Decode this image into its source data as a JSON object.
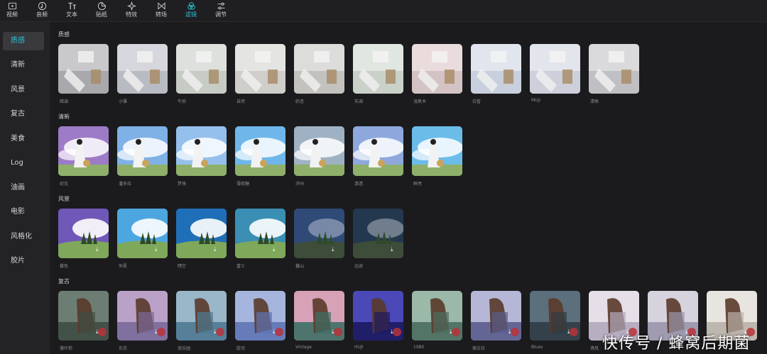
{
  "toolbar": {
    "items": [
      {
        "label": "视频",
        "icon": "video-play-icon"
      },
      {
        "label": "音频",
        "icon": "music-note-icon"
      },
      {
        "label": "文本",
        "icon": "text-icon"
      },
      {
        "label": "贴纸",
        "icon": "sticker-icon"
      },
      {
        "label": "特效",
        "icon": "sparkle-effect-icon"
      },
      {
        "label": "转场",
        "icon": "transition-bowtie-icon"
      },
      {
        "label": "滤镜",
        "icon": "filter-circles-icon",
        "active": true
      },
      {
        "label": "调节",
        "icon": "sliders-adjust-icon"
      }
    ],
    "accent_color": "#2bc4d6"
  },
  "sidebar": {
    "items": [
      {
        "label": "质感",
        "active": true
      },
      {
        "label": "清新"
      },
      {
        "label": "风景"
      },
      {
        "label": "复古"
      },
      {
        "label": "美食"
      },
      {
        "label": "Log"
      },
      {
        "label": "油画"
      },
      {
        "label": "电影"
      },
      {
        "label": "风格化"
      },
      {
        "label": "胶片"
      }
    ]
  },
  "sections": [
    {
      "title": "质感",
      "filters": [
        "暗调",
        "小雅",
        "午后",
        "自然",
        "奶杏",
        "灰调",
        "浅焦木",
        "白皙",
        "MUJI",
        "清晰"
      ]
    },
    {
      "title": "清新",
      "filters": [
        "初见",
        "潘多拉",
        "梦境",
        "薄荷糖",
        "济州",
        "清透",
        "鲜亮"
      ]
    },
    {
      "title": "风景",
      "filters": [
        "暮色",
        "仲夏",
        "晴空",
        "富士",
        "暮山",
        "远途"
      ]
    },
    {
      "title": "复古",
      "filters": [
        "落叶棕",
        "东京",
        "旅乐园",
        "胶司",
        "Vintage",
        "HUJI",
        "1980",
        "德古拉",
        "Blues",
        "港风",
        "",
        ""
      ]
    }
  ],
  "watermark": "快传号 / 蜂窝后期菌"
}
